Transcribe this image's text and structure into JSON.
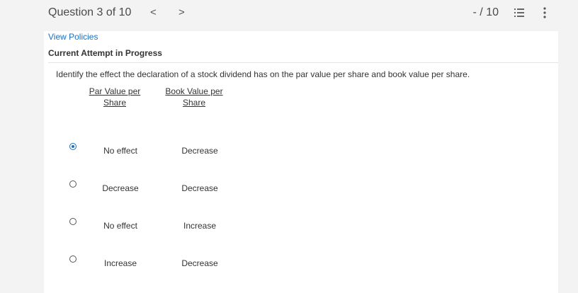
{
  "header": {
    "question_label": "Question 3 of 10",
    "prev_icon": "chevron-left",
    "next_icon": "chevron-right",
    "prev_glyph": "<",
    "next_glyph": ">",
    "score": "- / 10",
    "list_icon": "list-icon",
    "more_icon": "more-vertical-icon"
  },
  "links": {
    "view_policies": "View Policies"
  },
  "status": {
    "attempt": "Current Attempt in Progress"
  },
  "question": {
    "text": "Identify the effect the declaration of a stock dividend has on the par value per share and book value per share.",
    "columns": [
      {
        "line1": "Par Value per",
        "line2": "Share"
      },
      {
        "line1": "Book Value per",
        "line2": "Share"
      }
    ],
    "options": [
      {
        "par": "No effect",
        "book": "Decrease",
        "selected": true
      },
      {
        "par": "Decrease",
        "book": "Decrease",
        "selected": false
      },
      {
        "par": "No effect",
        "book": "Increase",
        "selected": false
      },
      {
        "par": "Increase",
        "book": "Decrease",
        "selected": false
      }
    ]
  },
  "colors": {
    "accent": "#1d6fbf",
    "background": "#f3f3f3",
    "panel": "#ffffff"
  }
}
